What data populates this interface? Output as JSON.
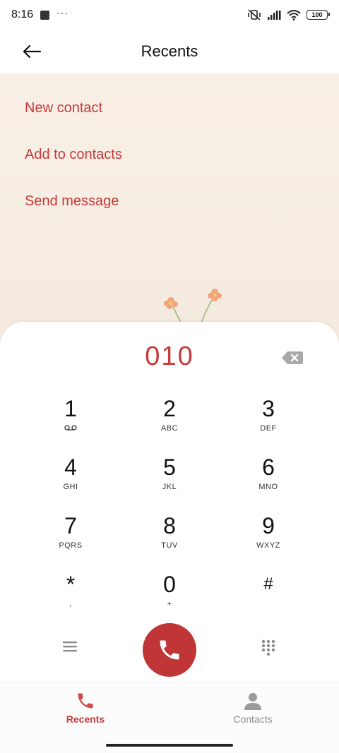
{
  "status_bar": {
    "time": "8:16",
    "more": "···",
    "battery": "100",
    "icons": [
      "vibrate-off-icon",
      "signal-icon",
      "wifi-icon",
      "battery-icon"
    ]
  },
  "header": {
    "title": "Recents",
    "back_icon": "arrow-left-icon"
  },
  "actions": {
    "new_contact": "New contact",
    "add_to_contacts": "Add to contacts",
    "send_message": "Send message"
  },
  "dialpad": {
    "number": "010",
    "keys": [
      {
        "digit": "1",
        "letters": ""
      },
      {
        "digit": "2",
        "letters": "ABC"
      },
      {
        "digit": "3",
        "letters": "DEF"
      },
      {
        "digit": "4",
        "letters": "GHI"
      },
      {
        "digit": "5",
        "letters": "JKL"
      },
      {
        "digit": "6",
        "letters": "MNO"
      },
      {
        "digit": "7",
        "letters": "PQRS"
      },
      {
        "digit": "8",
        "letters": "TUV"
      },
      {
        "digit": "9",
        "letters": "WXYZ"
      },
      {
        "digit": "*",
        "letters": ","
      },
      {
        "digit": "0",
        "letters": "+"
      },
      {
        "digit": "#",
        "letters": ""
      }
    ]
  },
  "bottom_nav": {
    "recents": "Recents",
    "contacts": "Contacts"
  },
  "colors": {
    "accent": "#c83a3a",
    "call_button": "#c03535"
  }
}
